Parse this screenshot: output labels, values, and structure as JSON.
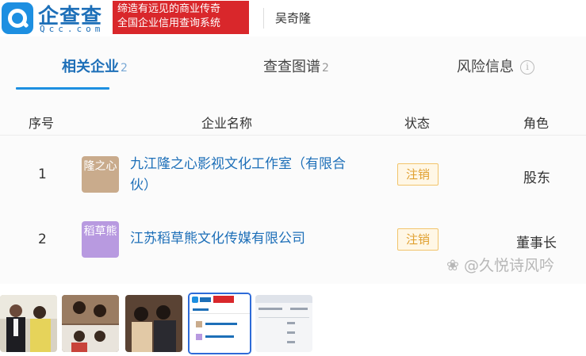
{
  "header": {
    "logo_cn": "企查查",
    "logo_en": "Qcc.com",
    "slogan_line1": "缔造有远见的商业传奇",
    "slogan_line2": "全国企业信用查询系统",
    "person": "吴奇隆"
  },
  "tabs": [
    {
      "label": "相关企业",
      "count": "2"
    },
    {
      "label": "查查图谱",
      "count": "2"
    },
    {
      "label": "风险信息",
      "count": ""
    }
  ],
  "table": {
    "headers": [
      "序号",
      "企业名称",
      "状态",
      "角色"
    ],
    "rows": [
      {
        "index": "1",
        "badge": "隆之心",
        "badge_color": "#c9ab8c",
        "name_line1": "九江隆之心影视文化工作室（有限合",
        "name_line2": "伙）",
        "status": "注销",
        "role": "股东"
      },
      {
        "index": "2",
        "badge": "稻草熊",
        "badge_color": "#b89ae0",
        "name_line1": "江苏稻草熊文化传媒有限公司",
        "name_line2": "",
        "status": "注销",
        "role": "董事长"
      }
    ]
  },
  "watermark": "@久悦诗风吟",
  "colors": {
    "brand_blue": "#1d6fb8",
    "brand_red": "#d9272b",
    "status_orange": "#e0a030"
  },
  "thumbnails": [
    {
      "label": "wedding-couple-photo",
      "selected": false
    },
    {
      "label": "drama-stills-photo",
      "selected": false
    },
    {
      "label": "group-wedding-photo",
      "selected": false
    },
    {
      "label": "qcc-screenshot",
      "selected": true
    },
    {
      "label": "document-screenshot",
      "selected": false
    }
  ]
}
